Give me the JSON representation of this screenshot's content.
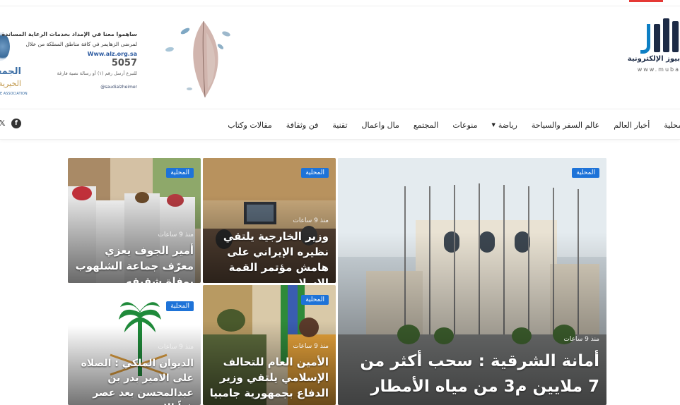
{
  "colors": {
    "accent": "#1e73d8",
    "brand_dark": "#1d2b46",
    "brand_blue": "#0d7fc4",
    "top_accent": "#e53935"
  },
  "logo": {
    "name": "بيوز الإلكترونية",
    "url": "www.muba"
  },
  "banner": {
    "org_name": "الجمعية",
    "org_name2": "الخيرية ا",
    "org_en": "E ASSOCIATION",
    "line1": "ساهموا معنا في الإمداد بخدمات الرعاية المساندة",
    "line2": "لمرضى الزهايمر في كافة مناطق المملكة من خلال",
    "url": "Www.alz.org.sa",
    "number": "5057",
    "sms": "للتبرع أرسل رقم (١) أو رسالة نصية فارغة",
    "social": "@saudialzheimer"
  },
  "nav": {
    "items": [
      {
        "label": "المحلية",
        "dropdown": false
      },
      {
        "label": "أخبار العالم",
        "dropdown": false
      },
      {
        "label": "عالم السفر والسياحة",
        "dropdown": false
      },
      {
        "label": "رياضة",
        "dropdown": true
      },
      {
        "label": "منوعات",
        "dropdown": false
      },
      {
        "label": "المجتمع",
        "dropdown": false
      },
      {
        "label": "مال واعمال",
        "dropdown": false
      },
      {
        "label": "تقنية",
        "dropdown": false
      },
      {
        "label": "فن وثقافة",
        "dropdown": false
      },
      {
        "label": "مقالات وكتاب",
        "dropdown": false
      }
    ],
    "social_icons": [
      "facebook-icon",
      "twitter-icon"
    ]
  },
  "cards": [
    {
      "category": "المحلية",
      "time": "منذ 9 ساعات",
      "title": "أمانة الشرقية : سحب أكثر من 7 ملايين م3 من مياه الأمطار"
    },
    {
      "category": "المحلية",
      "time": "منذ 9 ساعات",
      "title": "وزير الخارجية يلتقي نظيره الإيراني على هامش مؤتمر القمة الإسلامي"
    },
    {
      "category": "المحلية",
      "time": "منذ 9 ساعات",
      "title": "أمير الجوف يعزي معرّف جماعة الشلهوب بوفاة شقيقه"
    },
    {
      "category": "المحلية",
      "time": "منذ 9 ساعات",
      "title": "الأمين العام للتحالف الإسلامي يلتقي وزير الدفاع بجمهورية جامبيا"
    },
    {
      "category": "المحلية",
      "time": "منذ 9 ساعات",
      "title": "الديوان الملكي : الصلاه على الامير بدر بن عبدالمحسن بعد عصر غداً الاحد"
    }
  ]
}
